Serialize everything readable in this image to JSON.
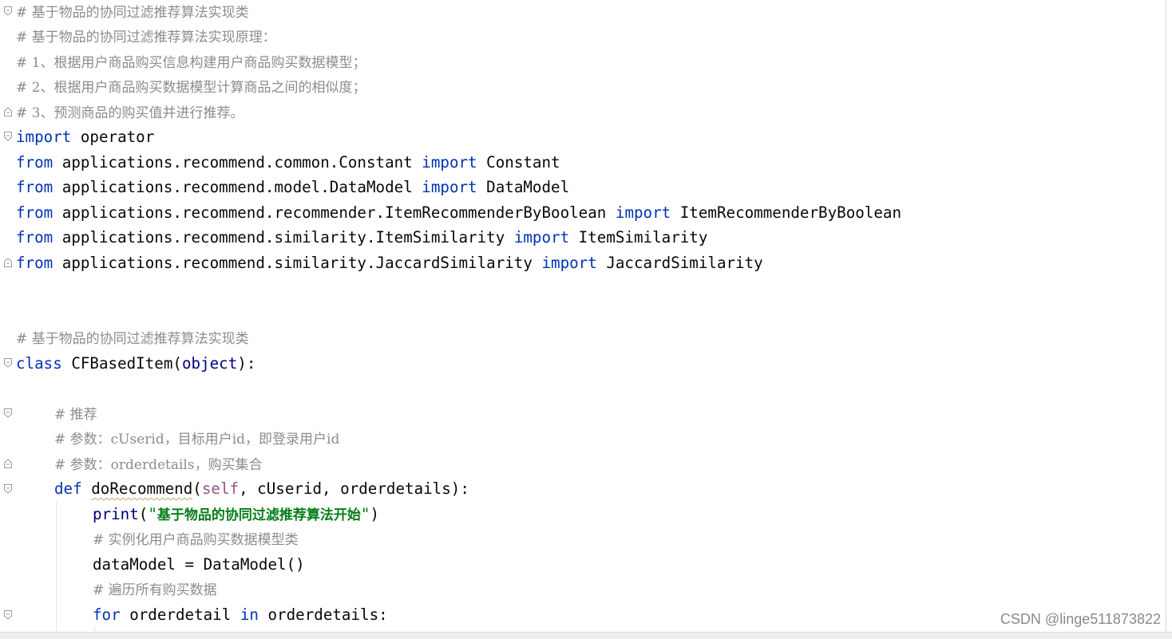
{
  "code": {
    "l1": "# 基于物品的协同过滤推荐算法实现类",
    "l2": "# 基于物品的协同过滤推荐算法实现原理：",
    "l3": "# 1、根据用户商品购买信息构建用户商品购买数据模型；",
    "l4": "# 2、根据用户商品购买数据模型计算商品之间的相似度；",
    "l5": "# 3、预测商品的购买值并进行推荐。",
    "l6_kw": "import",
    "l6_rest": " operator",
    "l7_mod": " applications.recommend.common.Constant ",
    "l7_name": " Constant",
    "l8_mod": " applications.recommend.model.DataModel ",
    "l8_name": " DataModel",
    "l9_mod": " applications.recommend.recommender.ItemRecommenderByBoolean ",
    "l9_name": " ItemRecommenderByBoolean",
    "l10_mod": " applications.recommend.similarity.ItemSimilarity ",
    "l10_name": " ItemSimilarity",
    "l11_mod": " applications.recommend.similarity.JaccardSimilarity ",
    "l11_name": " JaccardSimilarity",
    "kw_from": "from",
    "kw_import": "import",
    "l14": "# 基于物品的协同过滤推荐算法实现类",
    "l15_kw": "class",
    "l15_name": " CFBasedItem(",
    "l15_obj": "object",
    "l15_end": "):",
    "l17": "# 推荐",
    "l18": "# 参数：cUserid，目标用户id，即登录用户id",
    "l19": "# 参数：orderdetails，购买集合",
    "l20_kw": "def",
    "l20_name": "doRecommend",
    "l20_open": "(",
    "l20_self": "self",
    "l20_rest": ", cUserid, orderdetails):",
    "l21_print": "print",
    "l21_open": "(",
    "l21_q1": "\"",
    "l21_str": "基于物品的协同过滤推荐算法开始",
    "l21_q2": "\"",
    "l21_close": ")",
    "l22": "# 实例化用户商品购买数据模型类",
    "l23": "dataModel = DataModel()",
    "l24": "# 遍历所有购买数据",
    "l25_kw": "for",
    "l25_a": " orderdetail ",
    "l25_in": "in",
    "l25_b": " orderdetails:"
  },
  "watermark": "CSDN @linge511873822",
  "colors": {
    "keyword": "#0033b3",
    "comment": "#8c8c8c",
    "self": "#94558d",
    "builtin": "#000080",
    "string": "#067d17"
  }
}
